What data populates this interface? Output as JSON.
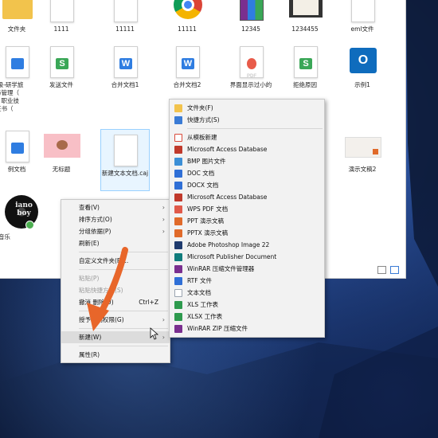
{
  "explorer": {
    "row1": [
      {
        "label": "文件夹",
        "kind": "folder"
      },
      {
        "label": "1111",
        "kind": "blank"
      },
      {
        "label": "11111",
        "kind": "blank"
      },
      {
        "label": "11111",
        "kind": "chrome"
      },
      {
        "label": "12345",
        "kind": "archive"
      },
      {
        "label": "1234455",
        "kind": "video"
      },
      {
        "label": "eml文件",
        "kind": "blank"
      }
    ],
    "row2": [
      {
        "label": "-级-研学旅\n与管理（\n）职业技\n证书（",
        "kind": "wps"
      },
      {
        "label": "发送文件",
        "kind": "wps-s"
      },
      {
        "label": "合并文档1",
        "kind": "wps-w"
      },
      {
        "label": "合并文档2",
        "kind": "wps-w"
      },
      {
        "label": "界面显示过小的",
        "kind": "pdf"
      },
      {
        "label": "拒绝原因",
        "kind": "wps-s"
      },
      {
        "label": "示例1",
        "kind": "outlook"
      }
    ],
    "row3": [
      {
        "label": "例文档",
        "kind": "wps"
      },
      {
        "label": "无标题",
        "kind": "pink"
      },
      {
        "label": "新建文本文档.caj",
        "kind": "blank-sel"
      },
      {
        "label": "演示文稿2",
        "kind": "ppt-img"
      }
    ],
    "music_label": "音乐",
    "album_text": "iano\nboy"
  },
  "context_menu": {
    "items": [
      {
        "label": "查看(V)",
        "arrow": true,
        "disabled": false
      },
      {
        "label": "排序方式(O)",
        "arrow": true,
        "disabled": false
      },
      {
        "label": "分组依据(P)",
        "arrow": true,
        "disabled": false
      },
      {
        "label": "刷新(E)",
        "arrow": false,
        "disabled": false
      },
      {
        "sep": true
      },
      {
        "label": "自定义文件夹(F)...",
        "arrow": false,
        "disabled": false
      },
      {
        "sep": true
      },
      {
        "label": "粘贴(P)",
        "arrow": false,
        "disabled": true
      },
      {
        "label": "粘贴快捷方式(S)",
        "arrow": false,
        "disabled": true
      },
      {
        "label": "撤消 删除(U)",
        "shortcut": "Ctrl+Z",
        "arrow": false,
        "disabled": false
      },
      {
        "sep": true
      },
      {
        "label": "授予访问权限(G)",
        "arrow": true,
        "disabled": false
      },
      {
        "sep": true
      },
      {
        "label": "新建(W)",
        "arrow": true,
        "disabled": false,
        "highlight": true
      },
      {
        "sep": true
      },
      {
        "label": "属性(R)",
        "arrow": false,
        "disabled": false
      }
    ]
  },
  "submenu": {
    "items": [
      {
        "label": "文件夹(F)",
        "icon": "folder-icon",
        "color": "#f2c34c"
      },
      {
        "label": "快捷方式(S)",
        "icon": "shortcut-icon",
        "color": "#3a7bd5"
      },
      {
        "sep": true
      },
      {
        "label": "从模板新建",
        "icon": "template-icon",
        "color": "#d94a3a"
      },
      {
        "label": "Microsoft Access Database",
        "icon": "access-icon",
        "color": "#c0392b"
      },
      {
        "label": "BMP 图片文件",
        "icon": "bmp-icon",
        "color": "#3c8fd6"
      },
      {
        "label": "DOC 文档",
        "icon": "doc-icon",
        "color": "#2f6fd6"
      },
      {
        "label": "DOCX 文档",
        "icon": "docx-icon",
        "color": "#2f6fd6"
      },
      {
        "label": "Microsoft Access Database",
        "icon": "access-icon",
        "color": "#c0392b"
      },
      {
        "label": "WPS PDF 文档",
        "icon": "pdf-icon",
        "color": "#e05a4a"
      },
      {
        "label": "PPT 演示文稿",
        "icon": "ppt-icon",
        "color": "#e06a2a"
      },
      {
        "label": "PPTX 演示文稿",
        "icon": "pptx-icon",
        "color": "#e06a2a"
      },
      {
        "label": "Adobe Photoshop Image 22",
        "icon": "photoshop-icon",
        "color": "#1f3b6e"
      },
      {
        "label": "Microsoft Publisher Document",
        "icon": "publisher-icon",
        "color": "#107c7c"
      },
      {
        "label": "WinRAR 压缩文件管理器",
        "icon": "winrar-icon",
        "color": "#7a2f8f"
      },
      {
        "label": "RTF 文件",
        "icon": "rtf-icon",
        "color": "#2f6fd6"
      },
      {
        "label": "文本文档",
        "icon": "txt-icon",
        "color": "#9aa4b0"
      },
      {
        "label": "XLS 工作表",
        "icon": "xls-icon",
        "color": "#2e9a4e"
      },
      {
        "label": "XLSX 工作表",
        "icon": "xlsx-icon",
        "color": "#2e9a4e"
      },
      {
        "label": "WinRAR ZIP 压缩文件",
        "icon": "winrar-zip-icon",
        "color": "#7a2f8f"
      }
    ]
  },
  "colors": {
    "wps_green": "#3aa757",
    "wps_blue": "#2f7de1",
    "pdf_red": "#e85b4a",
    "arrow_orange": "#e8662a"
  }
}
